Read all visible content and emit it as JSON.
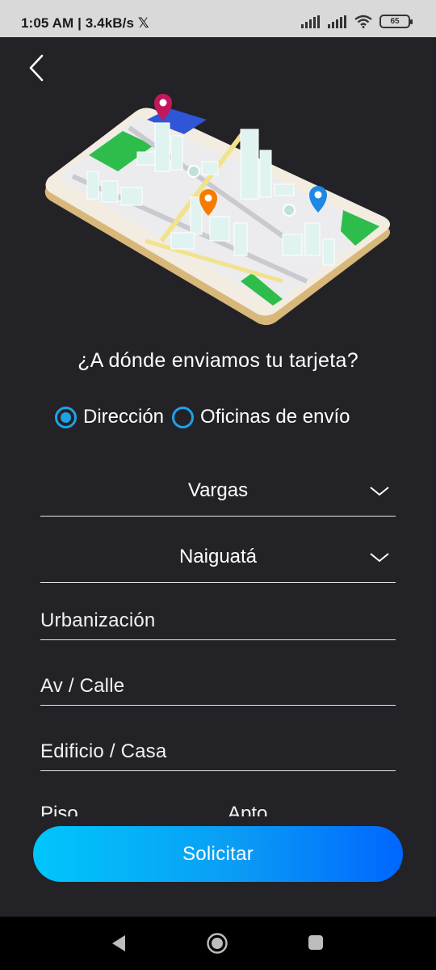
{
  "status_bar": {
    "time": "1:05 AM | 3.4kB/s",
    "x_glyph": "𝕏",
    "battery": "65"
  },
  "header": {
    "back_icon": "chevron-left-icon"
  },
  "illustration": {
    "name": "phone-city-map-illustration",
    "pin_colors": [
      "#c2185b",
      "#f57c00",
      "#1e88e5"
    ]
  },
  "main": {
    "question": "¿A dónde enviamos tu tarjeta?",
    "delivery_options": [
      {
        "label": "Dirección",
        "selected": true
      },
      {
        "label": "Oficinas de envío",
        "selected": false
      }
    ],
    "state_select": {
      "value": "Vargas"
    },
    "city_select": {
      "value": "Naiguatá"
    },
    "fields": {
      "urbanization": "Urbanización",
      "street": "Av / Calle",
      "building": "Edificio / Casa",
      "floor": "Piso",
      "apartment": "Apto"
    },
    "submit_label": "Solicitar"
  },
  "colors": {
    "background": "#232227",
    "accent": "#1fa2e6",
    "button_start": "#00c6fb",
    "button_end": "#0066ff"
  }
}
